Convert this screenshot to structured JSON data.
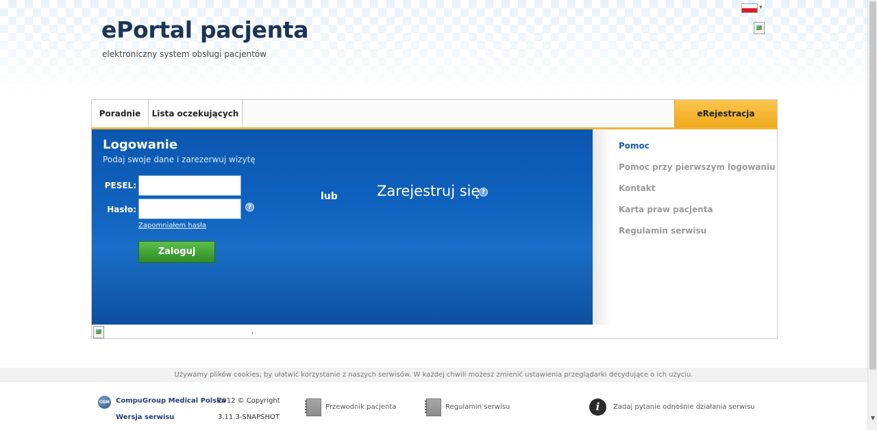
{
  "header": {
    "title": "ePortal pacjenta",
    "subtitle": "elektroniczny system obsługi pacjentów",
    "language_flag": "pl-flag-icon"
  },
  "nav": {
    "tabs": [
      {
        "label": "Poradnie"
      },
      {
        "label": "Lista oczekujących"
      }
    ],
    "active_tab": "eRejestracja",
    "accent_color": "#f0b53a"
  },
  "login": {
    "title": "Logowanie",
    "subtitle": "Podaj swoje dane i zarezerwuj wizytę",
    "pesel_label": "PESEL:",
    "pesel_value": "",
    "password_label": "Hasło:",
    "password_value": "",
    "help_glyph": "?",
    "forgot_link": "Zapomniałem hasła",
    "submit_label": "Zaloguj",
    "or_label": "lub",
    "register_label": "Zarejestruj się",
    "panel_color": "#0b57b0"
  },
  "sidebar": {
    "heading": "Pomoc",
    "items": [
      {
        "label": "Pomoc przy pierwszym logowaniu"
      },
      {
        "label": "Kontakt"
      },
      {
        "label": "Karta praw pacjenta"
      },
      {
        "label": "Regulamin serwisu"
      }
    ]
  },
  "strip": {
    "dot": "."
  },
  "footer": {
    "cookie_notice": "Używamy plików cookies, by ułatwić korzystanie z naszych serwisów. W każdej chwili możesz zmienić ustawienia przeglądarki decydujące o ich użyciu.",
    "company": "CompuGroup Medical Polska",
    "copyright": "2012 © Copyright",
    "version_label": "Wersja serwisu",
    "version_value": "3.11.3-SNAPSHOT",
    "logo_text": "CGM",
    "links": [
      {
        "label": "Przewodnik pacjenta",
        "icon": "document-icon"
      },
      {
        "label": "Regulamin serwisu",
        "icon": "document-icon"
      }
    ],
    "question_label": "Zadaj pytanie odnośnie działania serwisu",
    "info_glyph": "i"
  }
}
